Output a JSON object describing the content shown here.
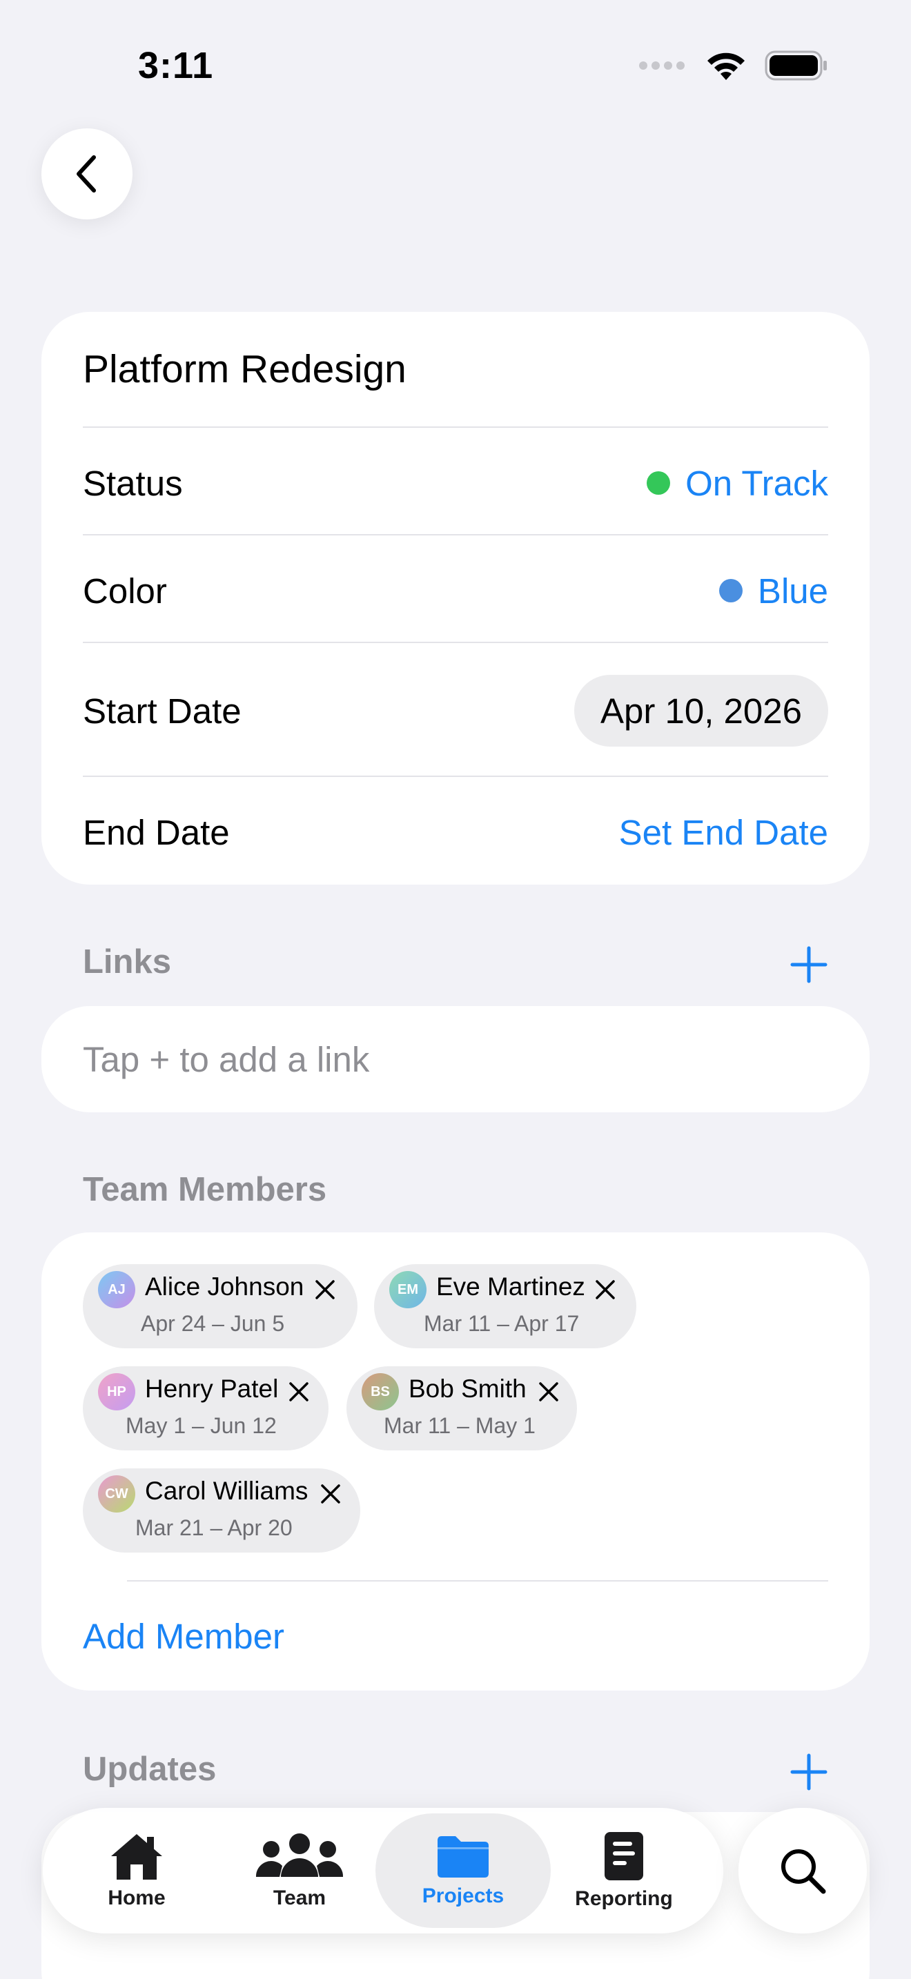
{
  "status_bar": {
    "time": "3:11"
  },
  "project": {
    "title": "Platform Redesign",
    "status": {
      "label": "Status",
      "value": "On Track",
      "dot_color": "#34c759"
    },
    "color": {
      "label": "Color",
      "value": "Blue",
      "dot_color": "#4a8fe0"
    },
    "start_date": {
      "label": "Start Date",
      "value": "Apr 10, 2026"
    },
    "end_date": {
      "label": "End Date",
      "value": "Set End Date"
    }
  },
  "links": {
    "header": "Links",
    "empty_text": "Tap + to add a link"
  },
  "team": {
    "header": "Team Members",
    "members": [
      {
        "initials": "AJ",
        "name": "Alice Johnson",
        "dates": "Apr 24 – Jun 5"
      },
      {
        "initials": "EM",
        "name": "Eve Martinez",
        "dates": "Mar 11 – Apr 17"
      },
      {
        "initials": "HP",
        "name": "Henry Patel",
        "dates": "May 1 – Jun 12"
      },
      {
        "initials": "BS",
        "name": "Bob Smith",
        "dates": "Mar 11 – May 1"
      },
      {
        "initials": "CW",
        "name": "Carol Williams",
        "dates": "Mar 21 – Apr 20"
      }
    ],
    "add_label": "Add Member"
  },
  "updates": {
    "header": "Updates"
  },
  "tab_bar": {
    "tabs": [
      {
        "label": "Home",
        "icon": "house-icon"
      },
      {
        "label": "Team",
        "icon": "people-icon"
      },
      {
        "label": "Projects",
        "icon": "folder-icon",
        "active": true
      },
      {
        "label": "Reporting",
        "icon": "document-icon"
      }
    ],
    "search_icon": "search-icon"
  },
  "colors": {
    "accent": "#1a84f5",
    "background": "#f2f2f7",
    "secondary_text": "#8e8e93"
  }
}
